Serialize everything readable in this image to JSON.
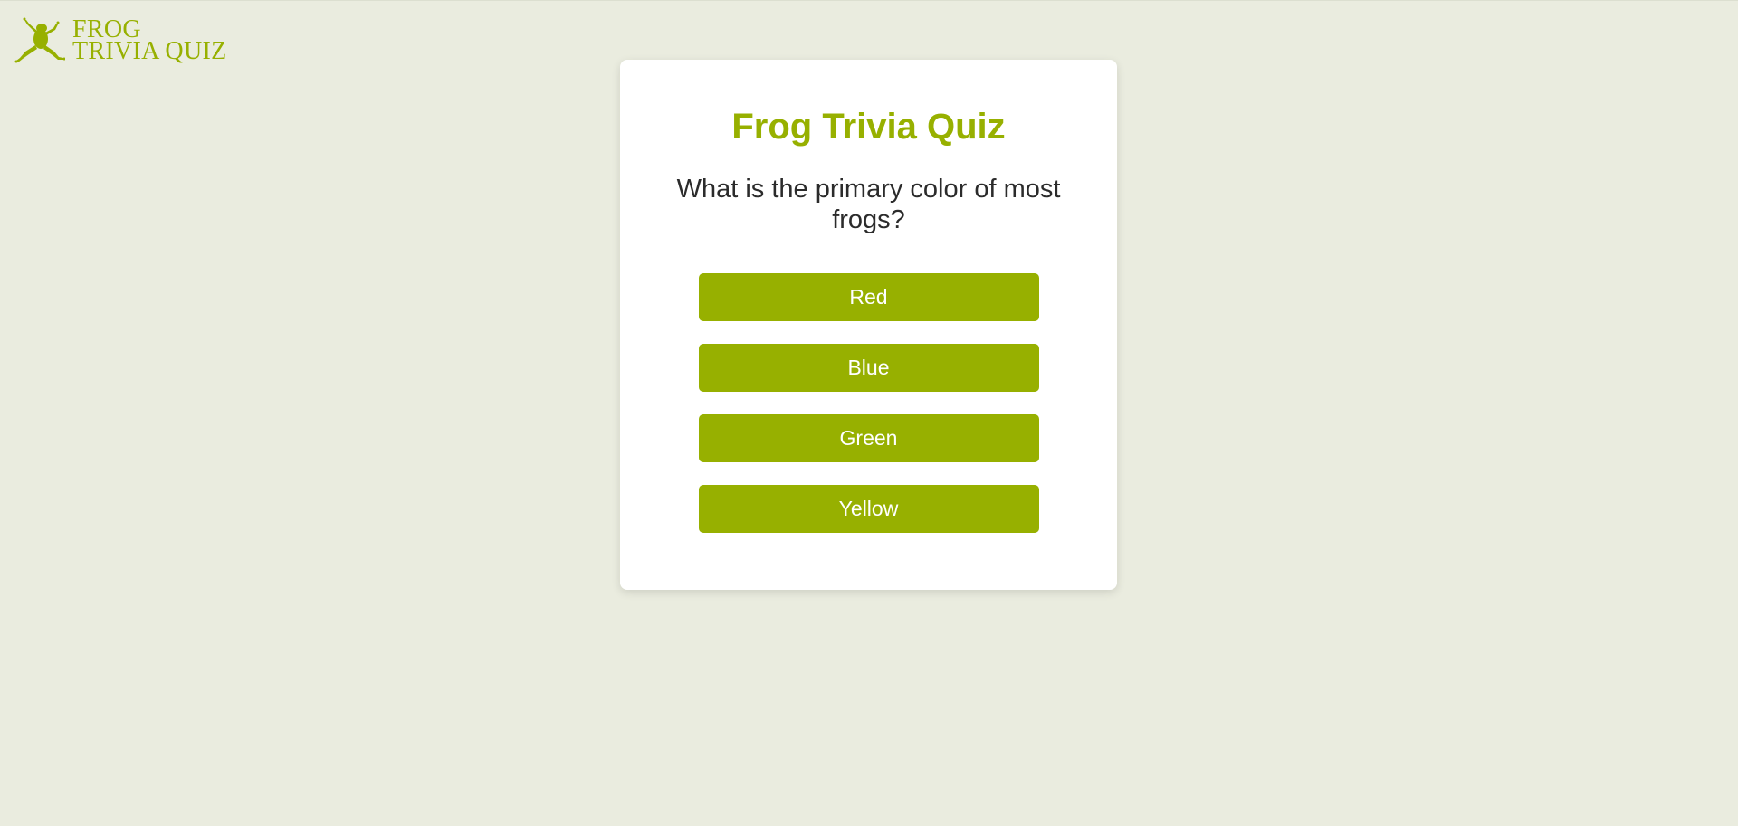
{
  "logo": {
    "icon": "frog-icon",
    "line1": "FROG",
    "line2": "TRIVIA QUIZ"
  },
  "quiz": {
    "title": "Frog Trivia Quiz",
    "question": "What is the primary color of most frogs?",
    "answers": [
      {
        "label": "Red"
      },
      {
        "label": "Blue"
      },
      {
        "label": "Green"
      },
      {
        "label": "Yellow"
      }
    ]
  },
  "colors": {
    "accent": "#97b000",
    "background": "#eaecdf",
    "card": "#ffffff",
    "text": "#2b2b2b"
  }
}
